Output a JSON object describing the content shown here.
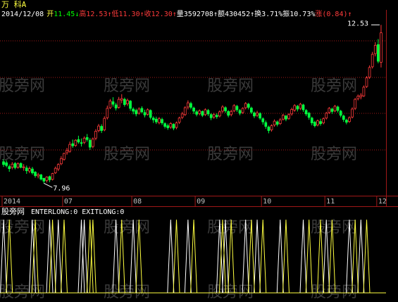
{
  "header": {
    "stock_name": "万  科A",
    "date": "2014/12/08",
    "fields": [
      {
        "label": "开",
        "value": "11.45",
        "arrow": "↓",
        "color": "#00ff00"
      },
      {
        "label": "高",
        "value": "12.53",
        "arrow": "↑",
        "color": "#ff3b3b"
      },
      {
        "label": "低",
        "value": "11.30",
        "arrow": "↑",
        "color": "#ff3b3b"
      },
      {
        "label": "收",
        "value": "12.30",
        "arrow": "↑",
        "color": "#ff3b3b"
      },
      {
        "label": "量",
        "value": "3592708",
        "arrow": "↑",
        "color": "#ffffff"
      },
      {
        "label": "额",
        "value": "430452",
        "arrow": "↑",
        "color": "#ffffff"
      },
      {
        "label": "换",
        "value": "3.71%",
        "arrow": "",
        "color": "#ffffff"
      },
      {
        "label": "振",
        "value": "10.73%",
        "arrow": "",
        "color": "#ffffff"
      },
      {
        "label": "涨",
        "value": "(0.84)",
        "arrow": "↑",
        "color": "#ff3b3b"
      }
    ]
  },
  "indicator_header": {
    "name": "股旁网",
    "text": "ENTERLONG:0 EXITLONG:0"
  },
  "watermark": "股旁网",
  "colors": {
    "up": "#ff3b3b",
    "down": "#00ff40",
    "grid": "#a01818",
    "axis": "#c0c0c0",
    "watermark": "#3a3a3a",
    "indicator_white": "#ffffff",
    "indicator_yellow": "#ffff40"
  },
  "chart_data": {
    "type": "candlestick",
    "title": "",
    "y_range": [
      7.6,
      12.8
    ],
    "high_marker": "12.53",
    "low_marker": "7.96",
    "x_tick_labels": [
      "2014",
      "07",
      "08",
      "09",
      "10",
      "11",
      "12"
    ],
    "x_tick_bar_index": [
      0,
      21,
      45,
      67,
      90,
      112,
      130
    ],
    "ohlc": [
      [
        8.58,
        8.65,
        8.43,
        8.5
      ],
      [
        8.55,
        8.62,
        8.42,
        8.47
      ],
      [
        8.44,
        8.5,
        8.29,
        8.38
      ],
      [
        8.42,
        8.57,
        8.36,
        8.51
      ],
      [
        8.53,
        8.57,
        8.36,
        8.41
      ],
      [
        8.42,
        8.56,
        8.38,
        8.52
      ],
      [
        8.53,
        8.56,
        8.39,
        8.42
      ],
      [
        8.42,
        8.51,
        8.32,
        8.43
      ],
      [
        8.4,
        8.47,
        8.23,
        8.32
      ],
      [
        8.31,
        8.44,
        8.25,
        8.38
      ],
      [
        8.37,
        8.43,
        8.21,
        8.26
      ],
      [
        8.28,
        8.31,
        8.12,
        8.18
      ],
      [
        8.17,
        8.26,
        8.1,
        8.21
      ],
      [
        8.2,
        8.23,
        8.04,
        8.08
      ],
      [
        8.1,
        8.12,
        7.96,
        8.02
      ],
      [
        8.04,
        8.16,
        7.98,
        8.14
      ],
      [
        8.15,
        8.18,
        7.99,
        8.06
      ],
      [
        8.07,
        8.26,
        8.04,
        8.24
      ],
      [
        8.26,
        8.44,
        8.23,
        8.39
      ],
      [
        8.37,
        8.54,
        8.31,
        8.5
      ],
      [
        8.52,
        8.74,
        8.48,
        8.67
      ],
      [
        8.65,
        8.84,
        8.61,
        8.82
      ],
      [
        8.84,
        8.98,
        8.78,
        8.9
      ],
      [
        8.88,
        9.16,
        8.84,
        9.08
      ],
      [
        9.1,
        9.22,
        8.98,
        9.04
      ],
      [
        9.05,
        9.23,
        9.01,
        9.2
      ],
      [
        9.22,
        9.33,
        9.1,
        9.15
      ],
      [
        9.13,
        9.25,
        9.02,
        9.12
      ],
      [
        9.14,
        9.31,
        9.09,
        9.26
      ],
      [
        9.28,
        9.38,
        9.16,
        9.22
      ],
      [
        9.2,
        9.26,
        8.92,
        9.0
      ],
      [
        9.02,
        9.28,
        8.97,
        9.24
      ],
      [
        9.26,
        9.52,
        9.2,
        9.46
      ],
      [
        9.48,
        9.67,
        9.43,
        9.61
      ],
      [
        9.6,
        9.66,
        9.41,
        9.48
      ],
      [
        9.5,
        9.89,
        9.46,
        9.83
      ],
      [
        9.85,
        10.2,
        9.8,
        10.12
      ],
      [
        10.14,
        10.39,
        10.1,
        10.33
      ],
      [
        10.31,
        10.44,
        10.17,
        10.24
      ],
      [
        10.22,
        10.28,
        10.06,
        10.13
      ],
      [
        10.15,
        10.45,
        10.11,
        10.38
      ],
      [
        10.36,
        10.53,
        10.27,
        10.4
      ],
      [
        10.38,
        10.43,
        10.17,
        10.23
      ],
      [
        10.25,
        10.4,
        10.19,
        10.35
      ],
      [
        10.33,
        10.36,
        10.05,
        10.12
      ],
      [
        10.1,
        10.15,
        9.95,
        10.04
      ],
      [
        10.06,
        10.11,
        9.89,
        9.96
      ],
      [
        9.98,
        10.15,
        9.94,
        10.1
      ],
      [
        10.12,
        10.18,
        9.98,
        10.02
      ],
      [
        10.0,
        10.08,
        9.86,
        9.93
      ],
      [
        9.95,
        10.12,
        9.91,
        10.08
      ],
      [
        10.06,
        10.09,
        9.8,
        9.86
      ],
      [
        9.84,
        9.89,
        9.7,
        9.79
      ],
      [
        9.81,
        9.88,
        9.67,
        9.73
      ],
      [
        9.71,
        9.87,
        9.66,
        9.82
      ],
      [
        9.8,
        9.85,
        9.64,
        9.7
      ],
      [
        9.68,
        9.72,
        9.54,
        9.6
      ],
      [
        9.62,
        9.68,
        9.5,
        9.56
      ],
      [
        9.58,
        9.72,
        9.53,
        9.68
      ],
      [
        9.66,
        9.69,
        9.49,
        9.55
      ],
      [
        9.57,
        9.74,
        9.52,
        9.7
      ],
      [
        9.72,
        9.88,
        9.67,
        9.84
      ],
      [
        9.86,
        10.02,
        9.81,
        9.96
      ],
      [
        9.94,
        10.18,
        9.9,
        10.14
      ],
      [
        10.16,
        10.35,
        10.09,
        10.28
      ],
      [
        10.26,
        10.31,
        10.09,
        10.15
      ],
      [
        10.13,
        10.17,
        9.96,
        10.04
      ],
      [
        10.02,
        10.07,
        9.89,
        9.95
      ],
      [
        9.97,
        10.09,
        9.92,
        10.05
      ],
      [
        10.03,
        10.06,
        9.87,
        9.92
      ],
      [
        9.94,
        10.12,
        9.9,
        10.08
      ],
      [
        10.06,
        10.1,
        9.9,
        9.96
      ],
      [
        9.94,
        9.98,
        9.78,
        9.85
      ],
      [
        9.87,
        9.99,
        9.82,
        9.94
      ],
      [
        9.92,
        9.98,
        9.82,
        9.88
      ],
      [
        9.9,
        10.06,
        9.86,
        10.02
      ],
      [
        10.04,
        10.21,
        9.99,
        10.16
      ],
      [
        10.14,
        10.18,
        9.99,
        10.05
      ],
      [
        10.03,
        10.07,
        9.86,
        9.92
      ],
      [
        9.94,
        10.08,
        9.89,
        10.03
      ],
      [
        10.05,
        10.24,
        10.01,
        10.2
      ],
      [
        10.18,
        10.22,
        10.02,
        10.08
      ],
      [
        10.06,
        10.1,
        9.92,
        9.98
      ],
      [
        10.0,
        10.15,
        9.96,
        10.12
      ],
      [
        10.14,
        10.3,
        10.09,
        10.26
      ],
      [
        10.24,
        10.28,
        10.09,
        10.15
      ],
      [
        10.13,
        10.17,
        9.96,
        10.01
      ],
      [
        9.99,
        10.03,
        9.84,
        9.9
      ],
      [
        9.92,
        10.05,
        9.87,
        9.99
      ],
      [
        9.97,
        10.01,
        9.79,
        9.84
      ],
      [
        9.82,
        9.86,
        9.65,
        9.73
      ],
      [
        9.71,
        9.77,
        9.53,
        9.6
      ],
      [
        9.58,
        9.62,
        9.4,
        9.48
      ],
      [
        9.5,
        9.66,
        9.45,
        9.62
      ],
      [
        9.64,
        9.8,
        9.59,
        9.75
      ],
      [
        9.73,
        9.77,
        9.6,
        9.66
      ],
      [
        9.68,
        9.84,
        9.64,
        9.79
      ],
      [
        9.81,
        9.96,
        9.77,
        9.92
      ],
      [
        9.9,
        9.93,
        9.75,
        9.81
      ],
      [
        9.83,
        9.98,
        9.79,
        9.94
      ],
      [
        9.96,
        10.14,
        9.91,
        10.09
      ],
      [
        10.07,
        10.24,
        10.02,
        10.2
      ],
      [
        10.18,
        10.22,
        10.03,
        10.1
      ],
      [
        10.12,
        10.28,
        10.07,
        10.24
      ],
      [
        10.22,
        10.25,
        10.02,
        10.08
      ],
      [
        10.06,
        10.1,
        9.9,
        9.96
      ],
      [
        9.98,
        10.02,
        9.79,
        9.86
      ],
      [
        9.84,
        9.88,
        9.63,
        9.7
      ],
      [
        9.72,
        9.76,
        9.57,
        9.62
      ],
      [
        9.64,
        9.8,
        9.6,
        9.76
      ],
      [
        9.74,
        9.82,
        9.62,
        9.68
      ],
      [
        9.7,
        9.86,
        9.66,
        9.82
      ],
      [
        9.84,
        10.02,
        9.8,
        9.98
      ],
      [
        10.0,
        10.16,
        9.96,
        10.12
      ],
      [
        10.1,
        10.14,
        9.96,
        10.03
      ],
      [
        10.05,
        10.22,
        10.01,
        10.18
      ],
      [
        10.16,
        10.2,
        10.0,
        10.06
      ],
      [
        10.04,
        10.08,
        9.86,
        9.92
      ],
      [
        9.9,
        9.94,
        9.73,
        9.8
      ],
      [
        9.78,
        9.82,
        9.66,
        9.72
      ],
      [
        9.74,
        9.89,
        9.7,
        9.85
      ],
      [
        9.87,
        10.15,
        9.83,
        10.1
      ],
      [
        10.12,
        10.42,
        10.07,
        10.38
      ],
      [
        10.4,
        10.52,
        10.35,
        10.47
      ],
      [
        10.45,
        10.56,
        10.38,
        10.5
      ],
      [
        10.48,
        10.78,
        10.45,
        10.73
      ],
      [
        10.75,
        11.05,
        10.71,
        11.0
      ],
      [
        11.02,
        11.36,
        10.97,
        11.3
      ],
      [
        11.32,
        11.75,
        11.27,
        11.68
      ],
      [
        11.7,
        12.03,
        11.62,
        11.94
      ],
      [
        11.96,
        12.12,
        11.42,
        11.48
      ],
      [
        11.45,
        12.53,
        11.3,
        12.3
      ]
    ],
    "indicator": {
      "white_spike_bars": [
        0,
        10,
        16,
        19,
        27,
        28,
        39,
        45,
        58,
        64,
        75,
        77,
        84,
        88,
        96,
        104,
        112,
        120,
        124
      ],
      "yellow_spike_bars": [
        2,
        11,
        17,
        21,
        30,
        31,
        41,
        47,
        60,
        66,
        76,
        79,
        86,
        90,
        98,
        106,
        110,
        114,
        122,
        126
      ],
      "baseline": 0,
      "spike_value": 1
    }
  }
}
